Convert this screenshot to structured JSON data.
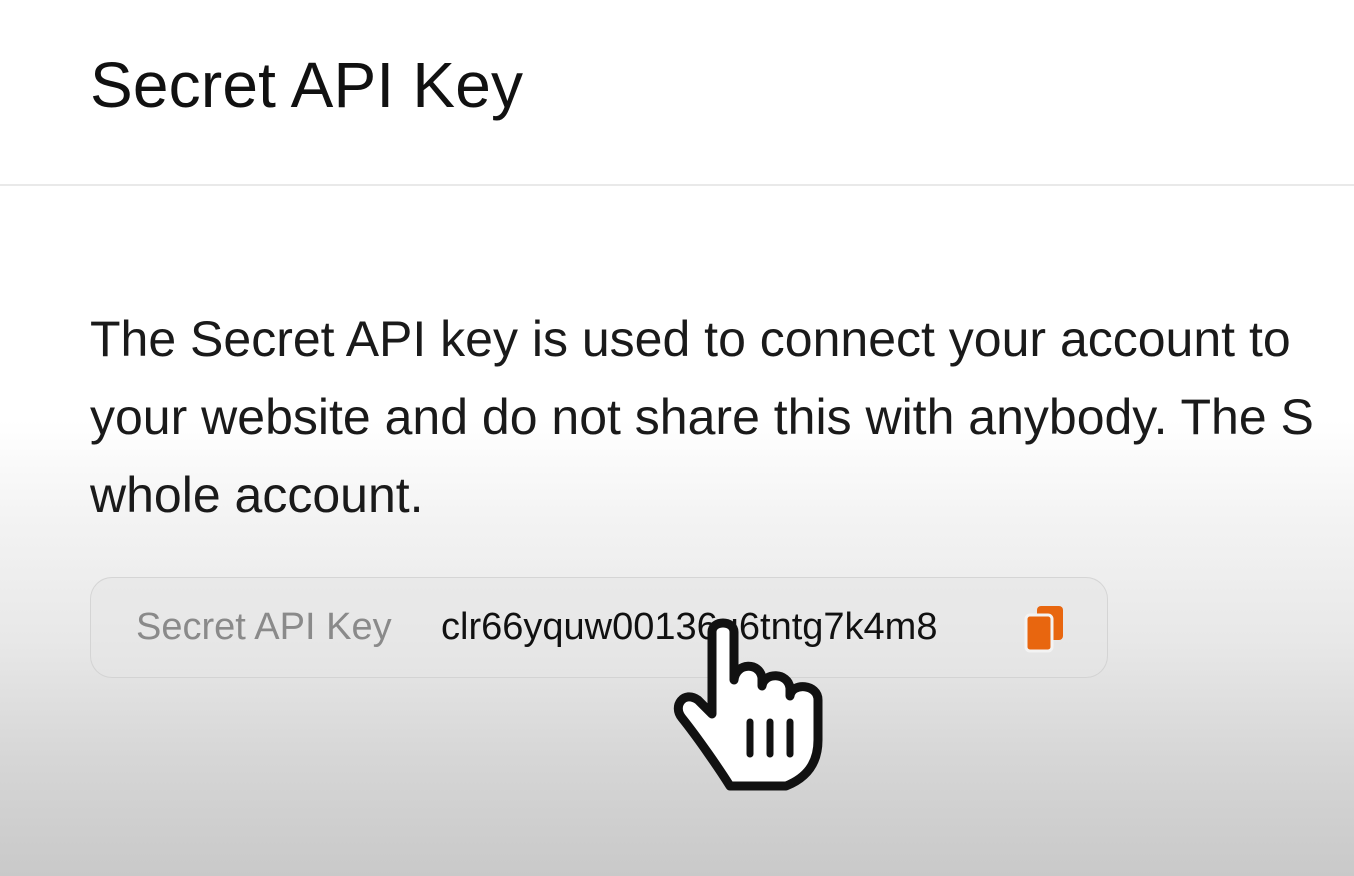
{
  "header": {
    "title": "Secret API Key"
  },
  "main": {
    "description_lines": [
      "The Secret API key is used to connect your account to",
      "your website and do not share this with anybody. The S",
      "whole account."
    ],
    "key_field": {
      "label": "Secret API Key",
      "value": "clr66yquw00136u6tntg7k4m8"
    }
  },
  "icons": {
    "copy": "copy-icon",
    "cursor": "hand-pointer-cursor-icon"
  },
  "colors": {
    "accent": "#e8660f",
    "label": "#8a8a8a",
    "text": "#111111"
  }
}
